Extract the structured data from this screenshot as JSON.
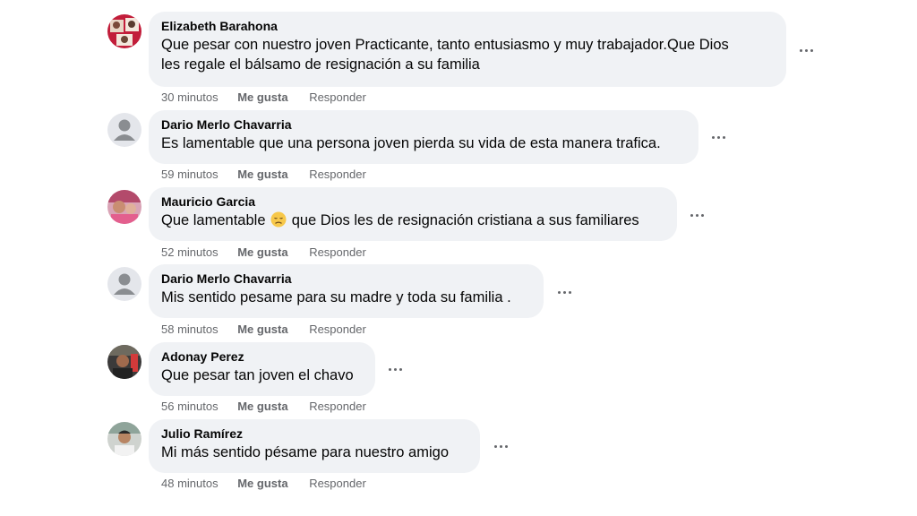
{
  "comments": [
    {
      "author": "Elizabeth Barahona",
      "text_lines": [
        "Que pesar con nuestro joven Practicante, tanto entusiasmo y muy trabajador.Que Dios",
        "les regale el bálsamo de resignación a su familia"
      ],
      "time": "30 minutos",
      "like_label": "Me gusta",
      "reply_label": "Responder",
      "avatar_icon": "profile-photo-icon"
    },
    {
      "author": "Dario Merlo Chavarria",
      "text_lines": [
        "Es lamentable que una persona joven pierda su vida de esta manera trafica."
      ],
      "time": "59 minutos",
      "like_label": "Me gusta",
      "reply_label": "Responder",
      "avatar_icon": "default-user-icon"
    },
    {
      "author": "Mauricio Garcia",
      "text_before_emoji": "Que lamentable",
      "emoji_icon": "disappointed-face-emoji",
      "text_after_emoji": "que Dios les de resignación cristiana a sus familiares",
      "time": "52 minutos",
      "like_label": "Me gusta",
      "reply_label": "Responder",
      "avatar_icon": "profile-photo-icon"
    },
    {
      "author": "Dario Merlo Chavarria",
      "text_lines": [
        "Mis sentido pesame para su madre y toda su familia ."
      ],
      "time": "58 minutos",
      "like_label": "Me gusta",
      "reply_label": "Responder",
      "avatar_icon": "default-user-icon"
    },
    {
      "author": "Adonay Perez",
      "text_lines": [
        "Que pesar tan joven el chavo"
      ],
      "time": "56 minutos",
      "like_label": "Me gusta",
      "reply_label": "Responder",
      "avatar_icon": "profile-photo-icon"
    },
    {
      "author": "Julio Ramírez",
      "text_lines": [
        "Mi más sentido pésame para nuestro amigo"
      ],
      "time": "48 minutos",
      "like_label": "Me gusta",
      "reply_label": "Responder",
      "avatar_icon": "profile-photo-icon"
    }
  ],
  "colors": {
    "bubble_bg": "#f0f2f5",
    "secondary_text": "#65676b",
    "primary_text": "#050505"
  }
}
